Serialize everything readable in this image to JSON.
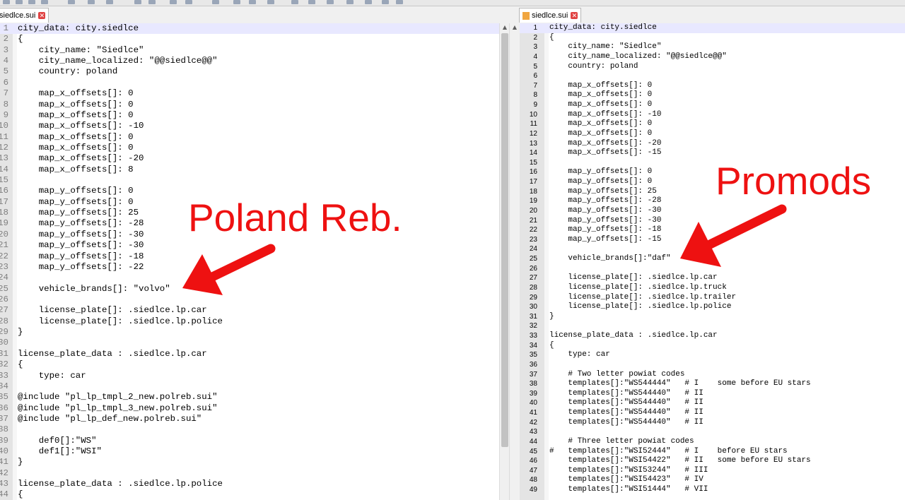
{
  "left_editor": {
    "tab_title": "siedlce.sui",
    "lines": [
      {
        "n": "1",
        "t": "city_data: city.siedlce"
      },
      {
        "n": "2",
        "t": "{"
      },
      {
        "n": "3",
        "t": "    city_name: \"Siedlce\""
      },
      {
        "n": "4",
        "t": "    city_name_localized: \"@@siedlce@@\""
      },
      {
        "n": "5",
        "t": "    country: poland"
      },
      {
        "n": "6",
        "t": ""
      },
      {
        "n": "7",
        "t": "    map_x_offsets[]: 0"
      },
      {
        "n": "8",
        "t": "    map_x_offsets[]: 0"
      },
      {
        "n": "9",
        "t": "    map_x_offsets[]: 0"
      },
      {
        "n": "10",
        "t": "    map_x_offsets[]: -10"
      },
      {
        "n": "11",
        "t": "    map_x_offsets[]: 0"
      },
      {
        "n": "12",
        "t": "    map_x_offsets[]: 0"
      },
      {
        "n": "13",
        "t": "    map_x_offsets[]: -20"
      },
      {
        "n": "14",
        "t": "    map_x_offsets[]: 8"
      },
      {
        "n": "15",
        "t": ""
      },
      {
        "n": "16",
        "t": "    map_y_offsets[]: 0"
      },
      {
        "n": "17",
        "t": "    map_y_offsets[]: 0"
      },
      {
        "n": "18",
        "t": "    map_y_offsets[]: 25"
      },
      {
        "n": "19",
        "t": "    map_y_offsets[]: -28"
      },
      {
        "n": "20",
        "t": "    map_y_offsets[]: -30"
      },
      {
        "n": "21",
        "t": "    map_y_offsets[]: -30"
      },
      {
        "n": "22",
        "t": "    map_y_offsets[]: -18"
      },
      {
        "n": "23",
        "t": "    map_y_offsets[]: -22"
      },
      {
        "n": "24",
        "t": ""
      },
      {
        "n": "25",
        "t": "    vehicle_brands[]: \"volvo\""
      },
      {
        "n": "26",
        "t": ""
      },
      {
        "n": "27",
        "t": "    license_plate[]: .siedlce.lp.car"
      },
      {
        "n": "28",
        "t": "    license_plate[]: .siedlce.lp.police"
      },
      {
        "n": "29",
        "t": "}"
      },
      {
        "n": "30",
        "t": ""
      },
      {
        "n": "31",
        "t": "license_plate_data : .siedlce.lp.car"
      },
      {
        "n": "32",
        "t": "{"
      },
      {
        "n": "33",
        "t": "    type: car"
      },
      {
        "n": "34",
        "t": ""
      },
      {
        "n": "35",
        "t": "@include \"pl_lp_tmpl_2_new.polreb.sui\""
      },
      {
        "n": "36",
        "t": "@include \"pl_lp_tmpl_3_new.polreb.sui\""
      },
      {
        "n": "37",
        "t": "@include \"pl_lp_def_new.polreb.sui\""
      },
      {
        "n": "38",
        "t": ""
      },
      {
        "n": "39",
        "t": "    def0[]:\"WS\""
      },
      {
        "n": "40",
        "t": "    def1[]:\"WSI\""
      },
      {
        "n": "41",
        "t": "}"
      },
      {
        "n": "42",
        "t": ""
      },
      {
        "n": "43",
        "t": "license_plate_data : .siedlce.lp.police"
      },
      {
        "n": "44",
        "t": "{"
      }
    ]
  },
  "right_editor": {
    "tab_title": "siedlce.sui",
    "lines": [
      {
        "n": "1",
        "t": "city_data: city.siedlce"
      },
      {
        "n": "2",
        "t": "{"
      },
      {
        "n": "3",
        "t": "    city_name: \"Siedlce\""
      },
      {
        "n": "4",
        "t": "    city_name_localized: \"@@siedlce@@\""
      },
      {
        "n": "5",
        "t": "    country: poland"
      },
      {
        "n": "6",
        "t": ""
      },
      {
        "n": "7",
        "t": "    map_x_offsets[]: 0"
      },
      {
        "n": "8",
        "t": "    map_x_offsets[]: 0"
      },
      {
        "n": "9",
        "t": "    map_x_offsets[]: 0"
      },
      {
        "n": "10",
        "t": "    map_x_offsets[]: -10"
      },
      {
        "n": "11",
        "t": "    map_x_offsets[]: 0"
      },
      {
        "n": "12",
        "t": "    map_x_offsets[]: 0"
      },
      {
        "n": "13",
        "t": "    map_x_offsets[]: -20"
      },
      {
        "n": "14",
        "t": "    map_x_offsets[]: -15"
      },
      {
        "n": "15",
        "t": ""
      },
      {
        "n": "16",
        "t": "    map_y_offsets[]: 0"
      },
      {
        "n": "17",
        "t": "    map_y_offsets[]: 0"
      },
      {
        "n": "18",
        "t": "    map_y_offsets[]: 25"
      },
      {
        "n": "19",
        "t": "    map_y_offsets[]: -28"
      },
      {
        "n": "20",
        "t": "    map_y_offsets[]: -30"
      },
      {
        "n": "21",
        "t": "    map_y_offsets[]: -30"
      },
      {
        "n": "22",
        "t": "    map_y_offsets[]: -18"
      },
      {
        "n": "23",
        "t": "    map_y_offsets[]: -15"
      },
      {
        "n": "24",
        "t": ""
      },
      {
        "n": "25",
        "t": "    vehicle_brands[]:\"daf\""
      },
      {
        "n": "26",
        "t": ""
      },
      {
        "n": "27",
        "t": "    license_plate[]: .siedlce.lp.car"
      },
      {
        "n": "28",
        "t": "    license_plate[]: .siedlce.lp.truck"
      },
      {
        "n": "29",
        "t": "    license_plate[]: .siedlce.lp.trailer"
      },
      {
        "n": "30",
        "t": "    license_plate[]: .siedlce.lp.police"
      },
      {
        "n": "31",
        "t": "}"
      },
      {
        "n": "32",
        "t": ""
      },
      {
        "n": "33",
        "t": "license_plate_data : .siedlce.lp.car"
      },
      {
        "n": "34",
        "t": "{"
      },
      {
        "n": "35",
        "t": "    type: car"
      },
      {
        "n": "36",
        "t": ""
      },
      {
        "n": "37",
        "t": "    # Two letter powiat codes"
      },
      {
        "n": "38",
        "t": "    templates[]:\"WS544444\"   # I    some before EU stars"
      },
      {
        "n": "39",
        "t": "    templates[]:\"WS544440\"   # II"
      },
      {
        "n": "40",
        "t": "    templates[]:\"WS544440\"   # II"
      },
      {
        "n": "41",
        "t": "    templates[]:\"WS544440\"   # II"
      },
      {
        "n": "42",
        "t": "    templates[]:\"WS544440\"   # II"
      },
      {
        "n": "43",
        "t": ""
      },
      {
        "n": "44",
        "t": "    # Three letter powiat codes"
      },
      {
        "n": "45",
        "t": "#   templates[]:\"WSI52444\"   # I    before EU stars"
      },
      {
        "n": "46",
        "t": "    templates[]:\"WSI54422\"   # II   some before EU stars"
      },
      {
        "n": "47",
        "t": "    templates[]:\"WSI53244\"   # III"
      },
      {
        "n": "48",
        "t": "    templates[]:\"WSI54423\"   # IV"
      },
      {
        "n": "49",
        "t": "    templates[]:\"WSI51444\"   # VII"
      }
    ]
  },
  "annotations": {
    "left_label": "Poland Reb.",
    "right_label": "Promods",
    "color": "#ee1111"
  },
  "icons": {
    "tab_close": "close-icon",
    "file": "file-icon",
    "scroll_up": "scroll-up-arrow-icon",
    "scroll_down": "scroll-down-arrow-icon"
  }
}
